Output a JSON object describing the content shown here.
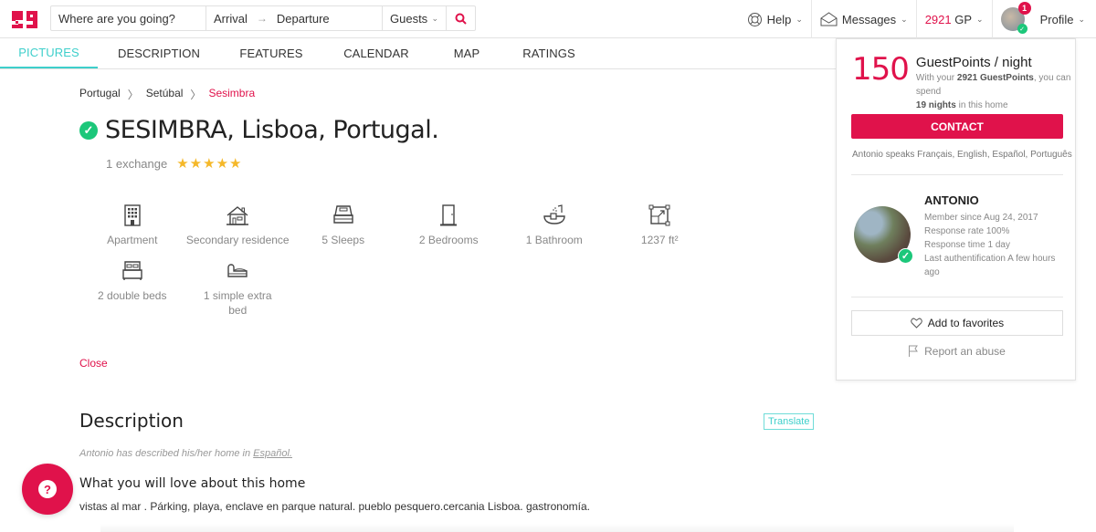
{
  "brand": {
    "accent": "#e0124b",
    "teal": "#3ecfcb",
    "green": "#1cc77a"
  },
  "search": {
    "where_placeholder": "Where are you going?",
    "arrival": "Arrival",
    "arrow": "→",
    "departure": "Departure",
    "guests": "Guests"
  },
  "nav": {
    "help": "Help",
    "messages": "Messages",
    "gp_value": "2921",
    "gp_unit": "GP",
    "notification_count": "1",
    "profile": "Profile"
  },
  "tabs": [
    {
      "label": "PICTURES",
      "active": true
    },
    {
      "label": "DESCRIPTION"
    },
    {
      "label": "FEATURES"
    },
    {
      "label": "CALENDAR"
    },
    {
      "label": "MAP"
    },
    {
      "label": "RATINGS"
    }
  ],
  "breadcrumb": [
    "Portugal",
    "Setúbal",
    "Sesimbra"
  ],
  "listing": {
    "title": "SESIMBRA, Lisboa, Portugal.",
    "exchanges": "1 exchange",
    "rating": 5,
    "stars": "★★★★★",
    "features": [
      {
        "icon": "building-icon",
        "label": "Apartment"
      },
      {
        "icon": "house-icon",
        "label": "Secondary residence"
      },
      {
        "icon": "bed-icon",
        "label": "5 Sleeps"
      },
      {
        "icon": "door-icon",
        "label": "2 Bedrooms"
      },
      {
        "icon": "bath-icon",
        "label": "1 Bathroom"
      },
      {
        "icon": "area-icon",
        "label": "1237 ft²"
      },
      {
        "icon": "double-bed-icon",
        "label": "2 double beds"
      },
      {
        "icon": "sofa-bed-icon",
        "label": "1 simple extra bed"
      }
    ],
    "close": "Close"
  },
  "description": {
    "title": "Description",
    "translate": "Translate",
    "note_prefix": "Antonio has described his/her home in ",
    "note_language": "Español.",
    "love_title": "What you will love about this home",
    "love_text": "vistas al mar . Párking, playa, enclave en parque natural. pueblo pesquero.cercania Lisboa. gastronomía."
  },
  "card": {
    "price": "150",
    "price_label": "GuestPoints / night",
    "sub_prefix": "With your ",
    "sub_points": "2921 GuestPoints",
    "sub_mid": ", you can spend ",
    "sub_nights": "19 nights",
    "sub_suffix": " in this home",
    "contact": "CONTACT",
    "speaks": "Antonio speaks Français, English, Español, Português",
    "host_name": "ANTONIO",
    "host_info": [
      "Member since Aug 24, 2017",
      "Response rate 100%",
      "Response time 1 day",
      "Last authentification A few hours ago"
    ],
    "favorites": "Add to favorites",
    "report": "Report an abuse"
  },
  "help_fab": "?"
}
